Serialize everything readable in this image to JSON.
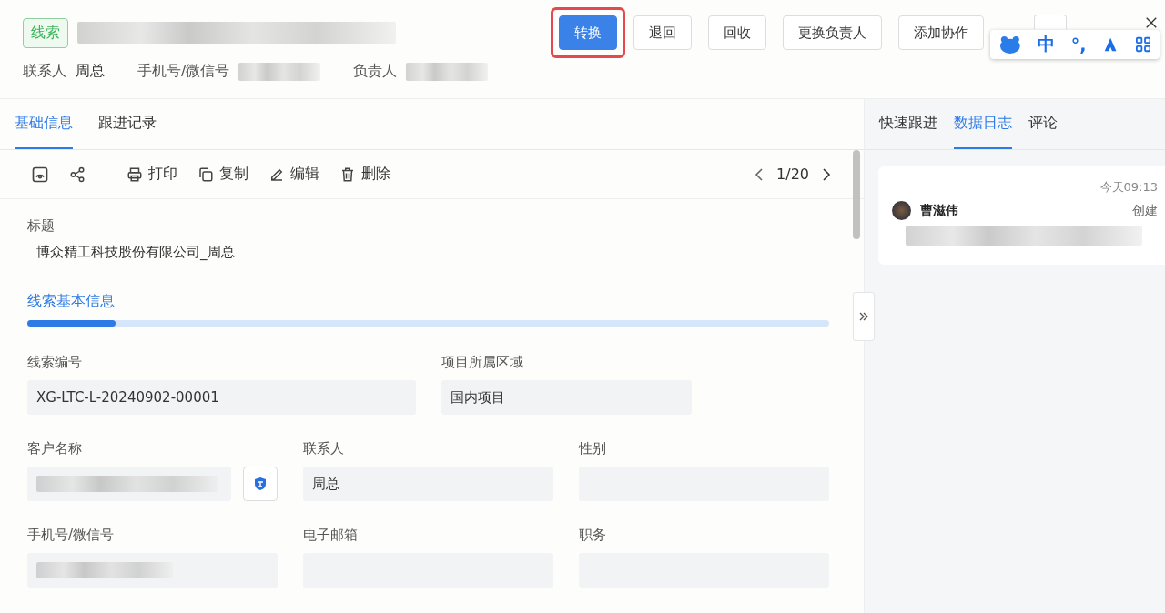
{
  "header": {
    "tag": "线索",
    "actions": [
      {
        "label": "转换",
        "primary": true,
        "highlighted": true
      },
      {
        "label": "退回",
        "primary": false,
        "highlighted": false
      },
      {
        "label": "回收",
        "primary": false,
        "highlighted": false
      },
      {
        "label": "更换负责人",
        "primary": false,
        "highlighted": false
      },
      {
        "label": "添加协作",
        "primary": false,
        "highlighted": false
      }
    ],
    "meta": [
      {
        "label": "联系人",
        "value": "周总"
      },
      {
        "label": "手机号/微信号"
      },
      {
        "label": "负责人"
      }
    ]
  },
  "ime_toolbar": {
    "items": [
      "中",
      "°,"
    ]
  },
  "tabs": [
    {
      "label": "基础信息",
      "selected": true
    },
    {
      "label": "跟进记录",
      "selected": false
    }
  ],
  "toolbar": {
    "actions": [
      {
        "label": "打印"
      },
      {
        "label": "复制"
      },
      {
        "label": "编辑"
      },
      {
        "label": "删除"
      }
    ],
    "pager": "1/20"
  },
  "title_field": {
    "label": "标题",
    "value": "博众精工科技股份有限公司_周总"
  },
  "section": {
    "label": "线索基本信息",
    "level": 0.11
  },
  "field_rows": [
    {
      "wide": true,
      "fields": [
        {
          "label": "线索编号",
          "value": "XG-LTC-L-20240902-00001",
          "blurred": false,
          "action": false
        },
        {
          "label": "项目所属区域",
          "value": "国内项目",
          "blurred": false,
          "action": false
        }
      ]
    },
    {
      "wide": false,
      "fields": [
        {
          "label": "客户名称",
          "blurred": true,
          "action": true
        },
        {
          "label": "联系人",
          "value": "周总",
          "blurred": false,
          "action": false
        },
        {
          "label": "性别",
          "blurred": false,
          "action": false
        }
      ]
    },
    {
      "wide": false,
      "fields": [
        {
          "label": "手机号/微信号",
          "blurred": true,
          "action": false
        },
        {
          "label": "电子邮箱",
          "blurred": false,
          "action": false
        },
        {
          "label": "职务",
          "blurred": false,
          "action": false
        }
      ]
    }
  ],
  "side": {
    "tabs": [
      {
        "label": "快速跟进",
        "selected": false
      },
      {
        "label": "数据日志",
        "selected": true
      },
      {
        "label": "评论",
        "selected": false
      }
    ],
    "log": [
      {
        "time": "今天09:13",
        "user": "曹滋伟",
        "action": "创建"
      }
    ]
  }
}
